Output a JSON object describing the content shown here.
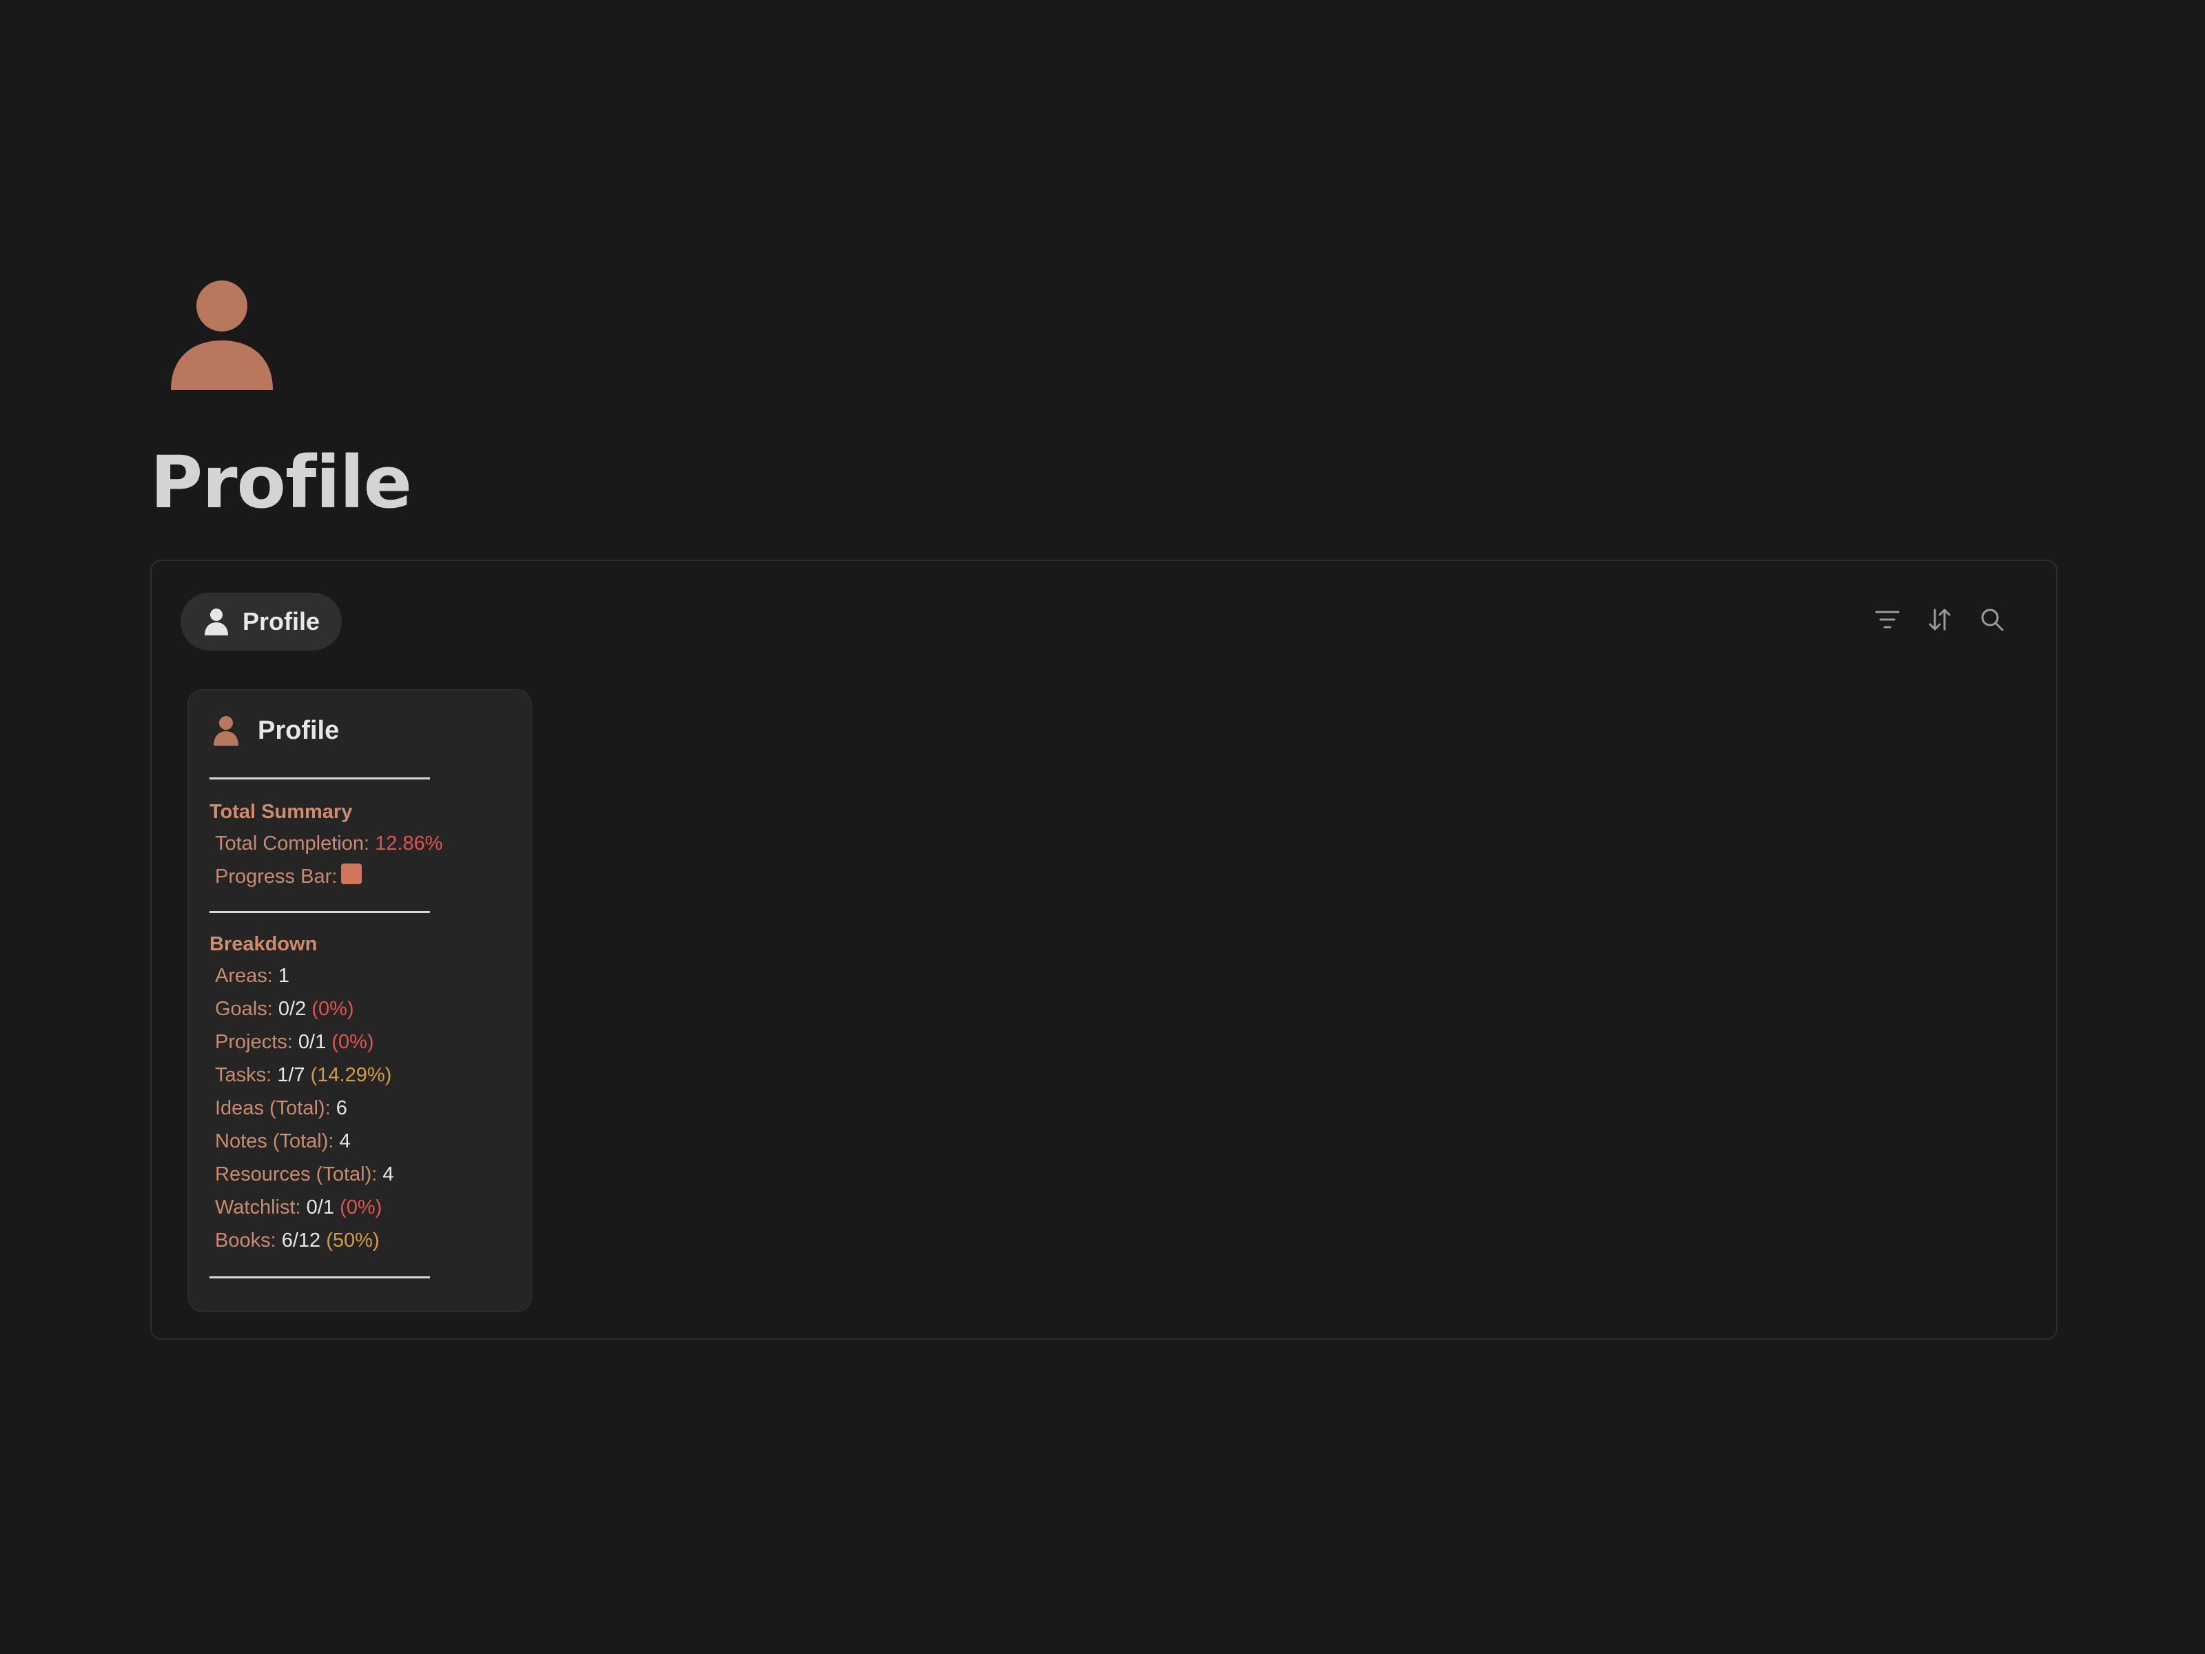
{
  "page": {
    "icon": "person-icon",
    "title": "Profile"
  },
  "view": {
    "tab_label": "Profile",
    "tab_icon": "person-icon",
    "toolbar": {
      "filter_icon": "filter-icon",
      "sort_icon": "sort-icon",
      "search_icon": "search-icon"
    }
  },
  "card": {
    "title": "Profile",
    "icon": "person-icon",
    "total_summary": {
      "heading": "Total Summary",
      "completion_label": "Total Completion:",
      "completion_value": "12.86%",
      "progress_label": "Progress Bar:",
      "progress_fraction": 0.1286
    },
    "breakdown": {
      "heading": "Breakdown",
      "items": [
        {
          "label": "Areas:",
          "value": "1",
          "pct": ""
        },
        {
          "label": "Goals:",
          "value": "0/2",
          "pct": "(0%)"
        },
        {
          "label": "Projects:",
          "value": "0/1",
          "pct": "(0%)"
        },
        {
          "label": "Tasks:",
          "value": "1/7",
          "pct": "(14.29%)"
        },
        {
          "label": "Ideas (Total):",
          "value": "6",
          "pct": ""
        },
        {
          "label": "Notes (Total):",
          "value": "4",
          "pct": ""
        },
        {
          "label": "Resources (Total):",
          "value": "4",
          "pct": ""
        },
        {
          "label": "Watchlist:",
          "value": "0/1",
          "pct": "(0%)"
        },
        {
          "label": "Books:",
          "value": "6/12",
          "pct": "(50%)"
        }
      ]
    }
  },
  "colors": {
    "background": "#191919",
    "accent": "#c98a6f",
    "icon": "#b9775e",
    "red": "#e0544e",
    "amber": "#d79a3d"
  }
}
